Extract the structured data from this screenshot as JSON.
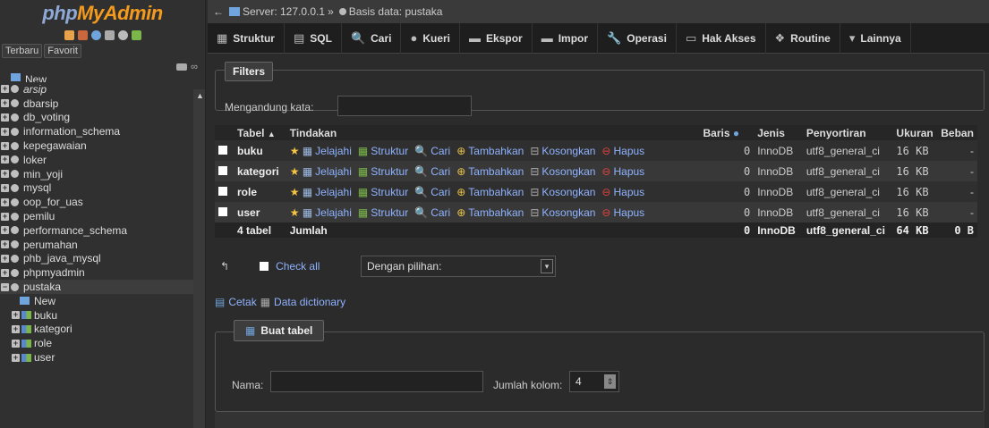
{
  "app": {
    "logo_a": "php",
    "logo_b": "MyAdmin"
  },
  "nav_tabs": {
    "recent": "Terbaru",
    "fav": "Favorit"
  },
  "breadcrumb": {
    "server": "Server: 127.0.0.1",
    "sep": "»",
    "db": "Basis data: pustaka"
  },
  "menu": [
    {
      "label": "Struktur",
      "icon": "▦"
    },
    {
      "label": "SQL",
      "icon": "▤"
    },
    {
      "label": "Cari",
      "icon": "🔍"
    },
    {
      "label": "Kueri",
      "icon": "●"
    },
    {
      "label": "Ekspor",
      "icon": "▬"
    },
    {
      "label": "Impor",
      "icon": "▬"
    },
    {
      "label": "Operasi",
      "icon": "🔧"
    },
    {
      "label": "Hak Akses",
      "icon": "▭"
    },
    {
      "label": "Routine",
      "icon": "❖"
    },
    {
      "label": "Lainnya",
      "icon": "▾"
    }
  ],
  "tree": [
    {
      "label": "New",
      "type": "new",
      "partial": true
    },
    {
      "label": "arsip",
      "type": "db",
      "italic": true
    },
    {
      "label": "dbarsip",
      "type": "db"
    },
    {
      "label": "db_voting",
      "type": "db"
    },
    {
      "label": "information_schema",
      "type": "db"
    },
    {
      "label": "kepegawaian",
      "type": "db"
    },
    {
      "label": "loker",
      "type": "db"
    },
    {
      "label": "min_yoji",
      "type": "db"
    },
    {
      "label": "mysql",
      "type": "db"
    },
    {
      "label": "oop_for_uas",
      "type": "db"
    },
    {
      "label": "pemilu",
      "type": "db"
    },
    {
      "label": "performance_schema",
      "type": "db"
    },
    {
      "label": "perumahan",
      "type": "db"
    },
    {
      "label": "phb_java_mysql",
      "type": "db"
    },
    {
      "label": "phpmyadmin",
      "type": "db"
    },
    {
      "label": "pustaka",
      "type": "db",
      "selected": true
    },
    {
      "label": "New",
      "type": "sub-new"
    },
    {
      "label": "buku",
      "type": "sub"
    },
    {
      "label": "kategori",
      "type": "sub"
    },
    {
      "label": "role",
      "type": "sub"
    },
    {
      "label": "user",
      "type": "sub"
    }
  ],
  "filters": {
    "legend": "Filters",
    "label": "Mengandung kata:",
    "value": ""
  },
  "table": {
    "headers": {
      "tabel": "Tabel",
      "sort": "▲",
      "tindakan": "Tindakan",
      "baris": "Baris",
      "jenis": "Jenis",
      "penyortiran": "Penyortiran",
      "ukuran": "Ukuran",
      "beban": "Beban"
    },
    "actions": [
      "Jelajahi",
      "Struktur",
      "Cari",
      "Tambahkan",
      "Kosongkan",
      "Hapus"
    ],
    "rows": [
      {
        "name": "buku",
        "baris": "0",
        "jenis": "InnoDB",
        "penyortiran": "utf8_general_ci",
        "ukuran": "16 KB",
        "beban": "-"
      },
      {
        "name": "kategori",
        "baris": "0",
        "jenis": "InnoDB",
        "penyortiran": "utf8_general_ci",
        "ukuran": "16 KB",
        "beban": "-"
      },
      {
        "name": "role",
        "baris": "0",
        "jenis": "InnoDB",
        "penyortiran": "utf8_general_ci",
        "ukuran": "16 KB",
        "beban": "-"
      },
      {
        "name": "user",
        "baris": "0",
        "jenis": "InnoDB",
        "penyortiran": "utf8_general_ci",
        "ukuran": "16 KB",
        "beban": "-"
      }
    ],
    "footer": {
      "count": "4 tabel",
      "label": "Jumlah",
      "baris": "0",
      "jenis": "InnoDB",
      "penyortiran": "utf8_general_ci",
      "ukuran": "64 KB",
      "beban": "0 B"
    }
  },
  "bulk": {
    "check_all": "Check all",
    "with_selected": "Dengan pilihan:"
  },
  "links": {
    "print": "Cetak",
    "dict": "Data dictionary"
  },
  "create": {
    "legend": "Buat tabel",
    "nama_label": "Nama:",
    "nama_value": "",
    "jk_label": "Jumlah kolom:",
    "jk_value": "4"
  }
}
